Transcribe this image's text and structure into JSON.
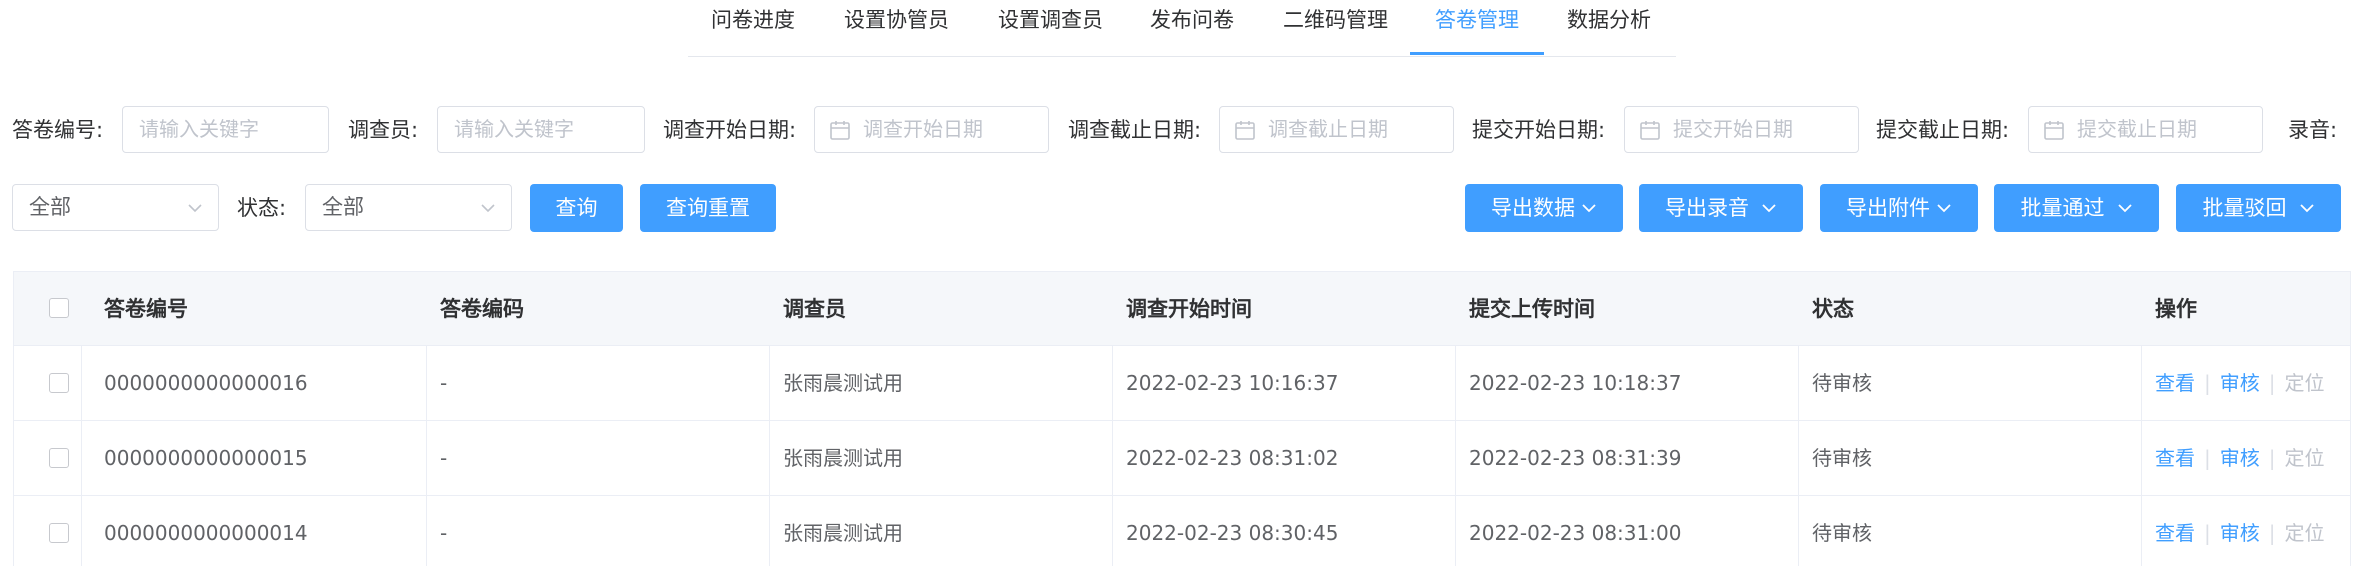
{
  "tabs": [
    "问卷进度",
    "设置协管员",
    "设置调查员",
    "发布问卷",
    "二维码管理",
    "答卷管理",
    "数据分析"
  ],
  "active_tab": "答卷管理",
  "filters": {
    "answer_no_label": "答卷编号:",
    "answer_no_placeholder": "请输入关键字",
    "investigator_label": "调查员:",
    "investigator_placeholder": "请输入关键字",
    "survey_start_label": "调查开始日期:",
    "survey_start_placeholder": "调查开始日期",
    "survey_end_label": "调查截止日期:",
    "survey_end_placeholder": "调查截止日期",
    "submit_start_label": "提交开始日期:",
    "submit_start_placeholder": "提交开始日期",
    "submit_end_label": "提交截止日期:",
    "submit_end_placeholder": "提交截止日期",
    "recording_label": "录音:",
    "recording_value": "全部",
    "status_label": "状态:",
    "status_value": "全部"
  },
  "buttons": {
    "query": "查询",
    "reset": "查询重置",
    "export_data": "导出数据",
    "export_recording": "导出录音",
    "export_attachment": "导出附件",
    "batch_approve": "批量通过",
    "batch_reject": "批量驳回"
  },
  "table": {
    "columns": [
      "答卷编号",
      "答卷编码",
      "调查员",
      "调查开始时间",
      "提交上传时间",
      "状态",
      "操作"
    ],
    "rows": [
      {
        "answer_no": "0000000000000016",
        "code": "-",
        "investigator": "张雨晨测试用",
        "start_time": "2022-02-23 10:16:37",
        "upload_time": "2022-02-23 10:18:37",
        "status": "待审核"
      },
      {
        "answer_no": "0000000000000015",
        "code": "-",
        "investigator": "张雨晨测试用",
        "start_time": "2022-02-23 08:31:02",
        "upload_time": "2022-02-23 08:31:39",
        "status": "待审核"
      },
      {
        "answer_no": "0000000000000014",
        "code": "-",
        "investigator": "张雨晨测试用",
        "start_time": "2022-02-23 08:30:45",
        "upload_time": "2022-02-23 08:31:00",
        "status": "待审核"
      }
    ],
    "actions": {
      "view": "查看",
      "review": "审核",
      "locate": "定位"
    }
  },
  "colors": {
    "primary": "#409eff",
    "border": "#dcdfe6",
    "header_bg": "#f5f7fa",
    "disabled": "#c0c4cc"
  },
  "icons": {
    "date": "calendar-icon",
    "dropdown": "chevron-down-icon"
  }
}
